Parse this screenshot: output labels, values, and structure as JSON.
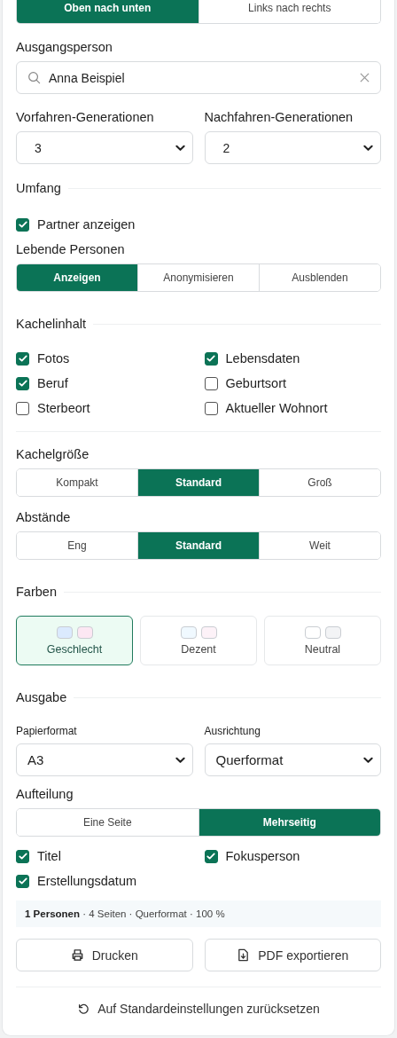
{
  "direction": {
    "options": [
      {
        "label": "Oben nach unten",
        "selected": true
      },
      {
        "label": "Links nach rechts",
        "selected": false
      }
    ]
  },
  "start_person": {
    "label": "Ausgangsperson",
    "value": "Anna Beispiel"
  },
  "generations": [
    {
      "label": "Vorfahren-Generationen",
      "value": "3"
    },
    {
      "label": "Nachfahren-Generationen",
      "value": "2"
    }
  ],
  "scope": {
    "heading": "Umfang",
    "partner": {
      "label": "Partner anzeigen",
      "checked": true
    },
    "living_label": "Lebende Personen",
    "living": [
      {
        "label": "Anzeigen",
        "selected": true
      },
      {
        "label": "Anonymisieren",
        "selected": false
      },
      {
        "label": "Ausblenden",
        "selected": false
      }
    ]
  },
  "tile_content": {
    "heading": "Kachelinhalt",
    "items": [
      {
        "label": "Fotos",
        "checked": true
      },
      {
        "label": "Lebensdaten",
        "checked": true
      },
      {
        "label": "Beruf",
        "checked": true
      },
      {
        "label": "Geburtsort",
        "checked": false
      },
      {
        "label": "Sterbeort",
        "checked": false
      },
      {
        "label": "Aktueller Wohnort",
        "checked": false
      }
    ]
  },
  "tile_size": {
    "label": "Kachelgröße",
    "options": [
      {
        "label": "Kompakt",
        "selected": false
      },
      {
        "label": "Standard",
        "selected": true
      },
      {
        "label": "Groß",
        "selected": false
      }
    ]
  },
  "spacing": {
    "label": "Abstände",
    "options": [
      {
        "label": "Eng",
        "selected": false
      },
      {
        "label": "Standard",
        "selected": true
      },
      {
        "label": "Weit",
        "selected": false
      }
    ]
  },
  "colors": {
    "heading": "Farben",
    "options": [
      {
        "label": "Geschlecht",
        "selected": true,
        "swatches": [
          {
            "color": "#dbeafe"
          },
          {
            "color": "#fce7f3"
          }
        ]
      },
      {
        "label": "Dezent",
        "selected": false,
        "swatches": [
          {
            "color": "#f0f9ff"
          },
          {
            "color": "#fdf2f8"
          }
        ]
      },
      {
        "label": "Neutral",
        "selected": false,
        "swatches": [
          {
            "color": "#ffffff"
          },
          {
            "color": "#f3f4f6"
          }
        ]
      }
    ]
  },
  "output": {
    "heading": "Ausgabe",
    "fields": [
      {
        "label": "Papierformat",
        "value": "A3"
      },
      {
        "label": "Ausrichtung",
        "value": "Querformat"
      }
    ],
    "split_label": "Aufteilung",
    "split": [
      {
        "label": "Eine Seite",
        "selected": false
      },
      {
        "label": "Mehrseitig",
        "selected": true
      }
    ],
    "options": [
      {
        "label": "Titel",
        "checked": true
      },
      {
        "label": "Fokusperson",
        "checked": true
      },
      {
        "label": "Erstellungsdatum",
        "checked": true
      }
    ]
  },
  "summary": "**1 Personen** · 4 Seiten · Querformat · 100 %",
  "buttons": [
    {
      "kind": "print",
      "label": "Drucken"
    },
    {
      "kind": "pdf",
      "label": "PDF exportieren"
    }
  ],
  "reset": "Auf Standardeinstellungen zurücksetzen"
}
